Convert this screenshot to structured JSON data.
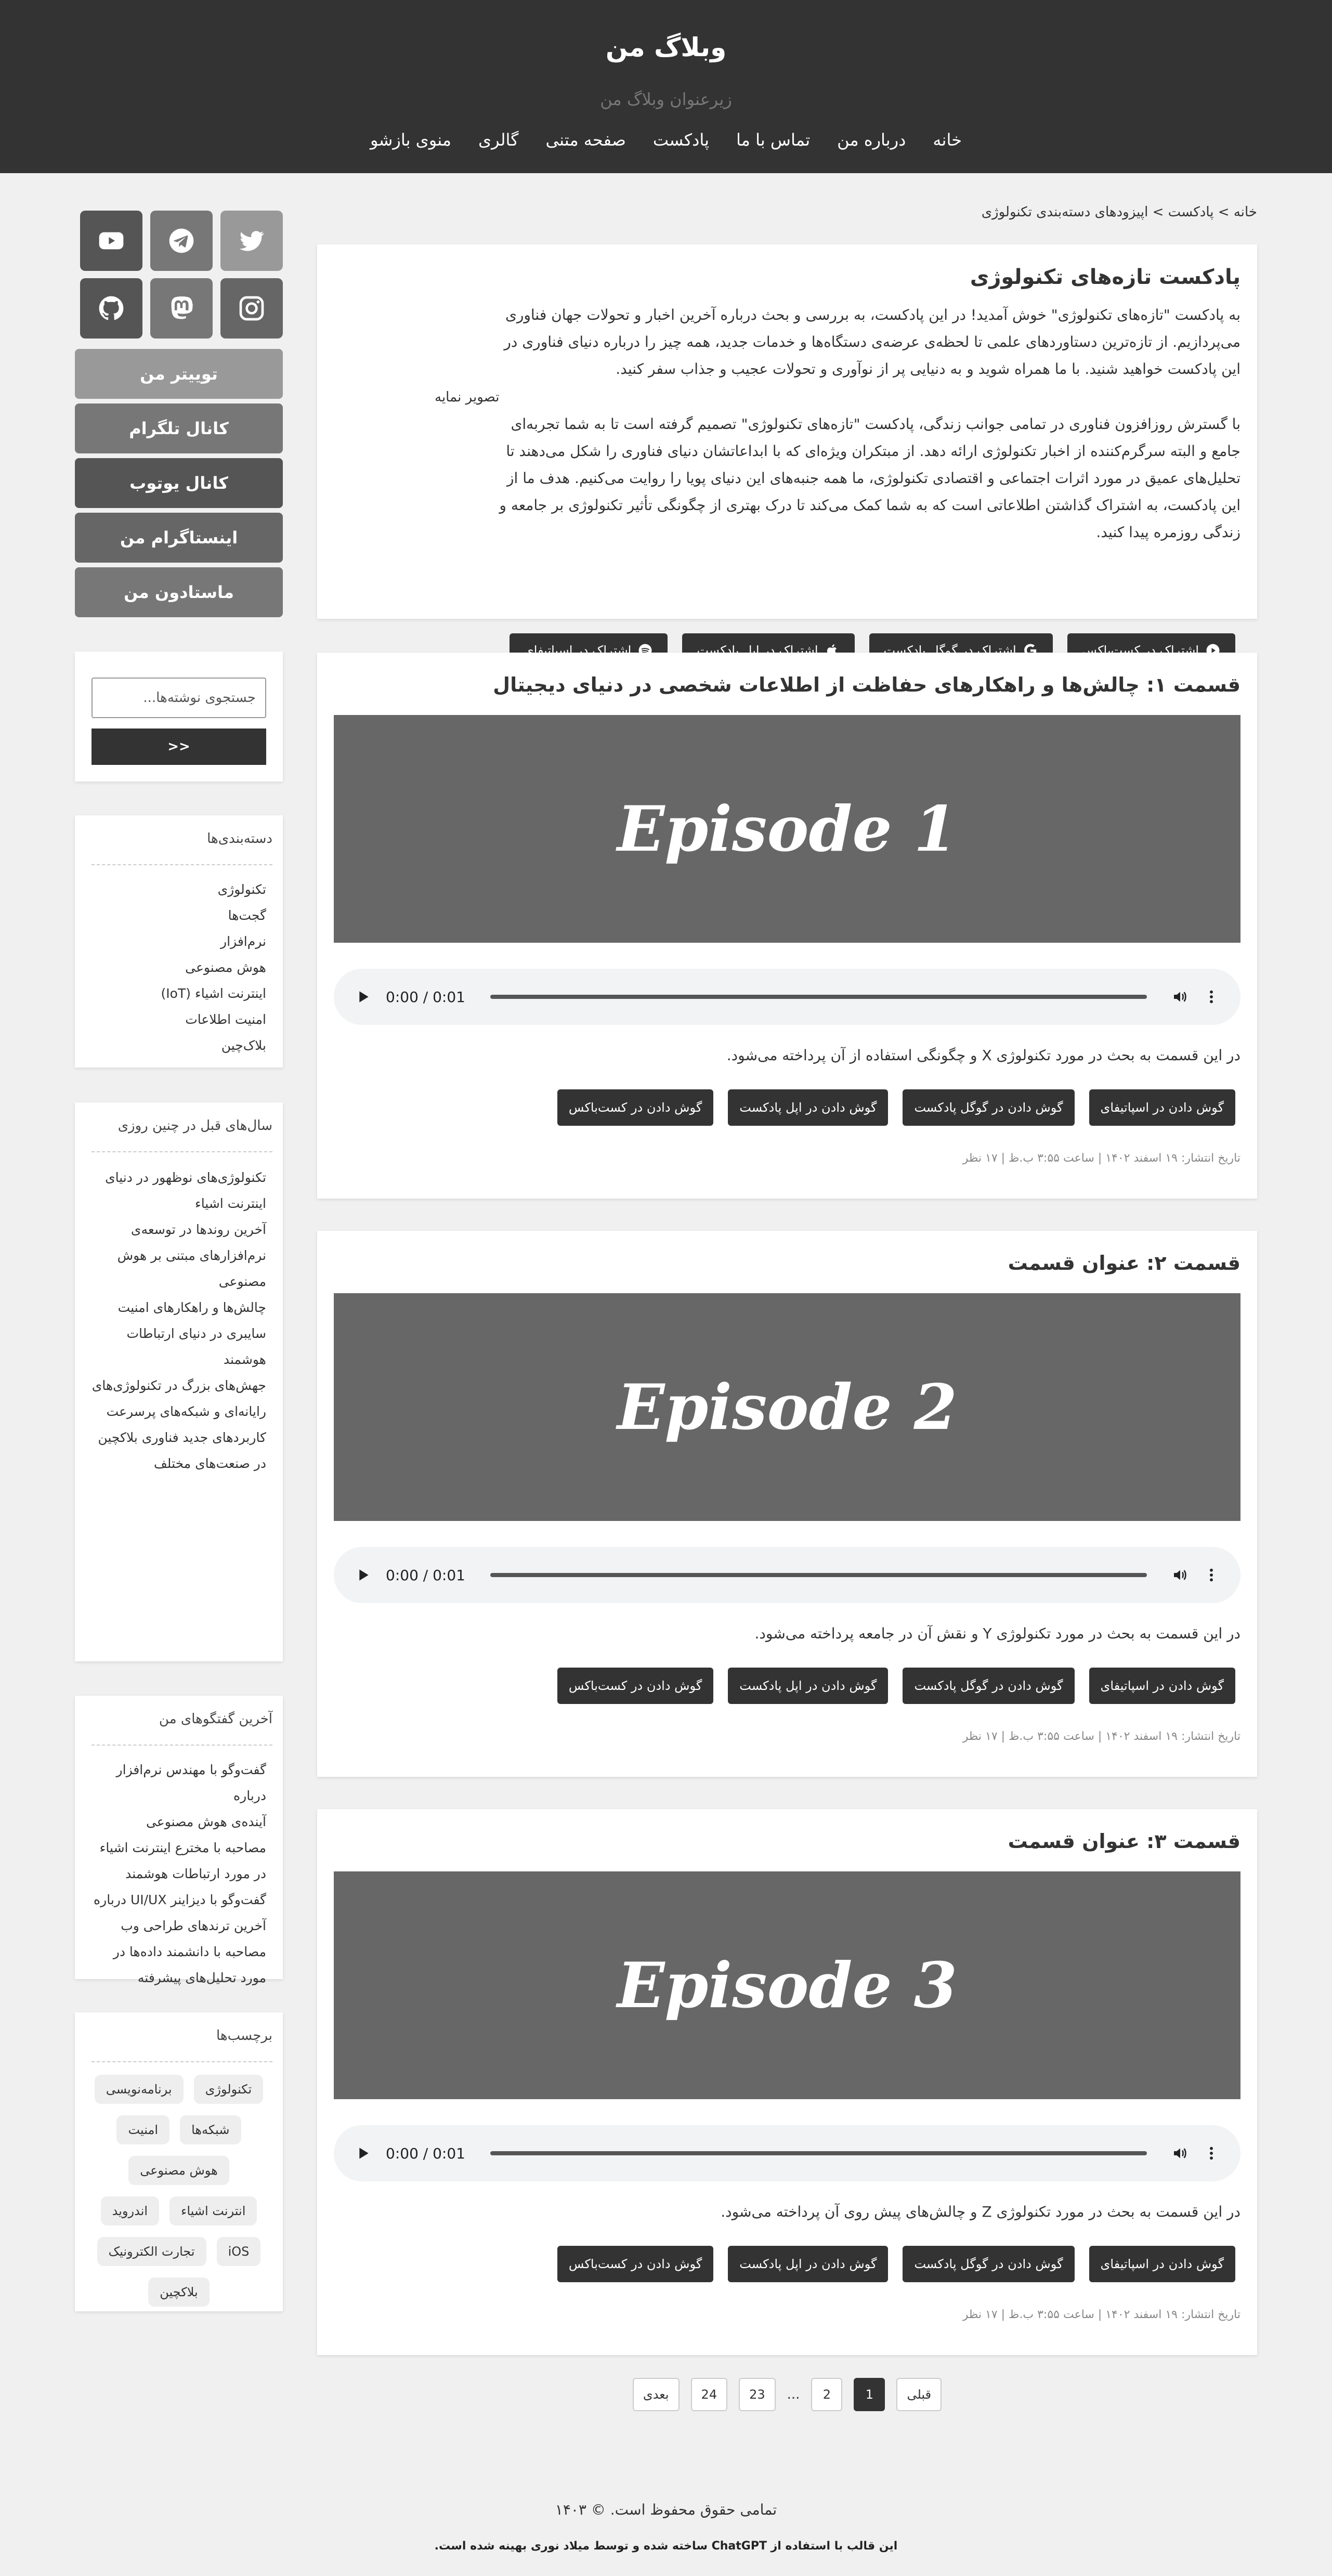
{
  "header": {
    "title": "وبلاگ من",
    "tagline": "زیرعنوان وبلاگ من",
    "nav": [
      "خانه",
      "درباره من",
      "تماس با ما",
      "پادکست",
      "صفحه متنی",
      "گالری",
      "منوی بازشو"
    ]
  },
  "breadcrumb": "خانه > پادکست > اپیزودهای دسته‌بندی تکنولوژی",
  "intro": {
    "title": "پادکست تازه‌های تکنولوژی",
    "paragraph1": "به پادکست \"تازه‌های تکنولوژی\" خوش آمدید! در این پادکست، به بررسی و بحث درباره آخرین اخبار و تحولات جهان فناوری می‌پردازیم. از تازه‌ترین دستاوردهای علمی تا لحظه‌ی عرضه‌ی دستگاه‌ها و خدمات جدید، همه چیز را درباره دنیای فناوری در این پادکست خواهید شنید. با ما همراه شوید و به دنیایی پر از نوآوری و تحولات عجیب و جذاب سفر کنید.",
    "paragraph2": "با گسترش روزافزون فناوری در تمامی جوانب زندگی، پادکست \"تازه‌های تکنولوژی\" تصمیم گرفته است تا به شما تجربه‌ای جامع و البته سرگرم‌کننده از اخبار تکنولوژی ارائه دهد. از مبتکران ویژه‌ای که با ابداعاتشان دنیای فناوری را شکل می‌دهند تا تحلیل‌های عمیق در مورد اثرات اجتماعی و اقتصادی تکنولوژی، ما همه جنبه‌های این دنیای پویا را روایت می‌کنیم. هدف ما از این پادکست، به اشتراک گذاشتن اطلاعاتی است که به شما کمک می‌کند تا درک بهتری از چگونگی تأثیر تکنولوژی بر جامعه و زندگی روزمره پیدا کنید.",
    "image_alt": "تصویر نمایه",
    "buttons": [
      "اشتراک در کست‌باکس",
      "اشتراک در گوگل پادکست",
      "اشتراک در اپل پادکست",
      "اشتراک در اسپاتیفای"
    ]
  },
  "episodes": [
    {
      "title": "قسمت ۱: چالش‌ها و راهکارهای حفاظت از اطلاعات شخصی در دنیای دیجیتال",
      "cover_text": "Episode 1",
      "time": "0:00 / 0:01",
      "description": "در این قسمت به بحث در مورد تکنولوژی X و چگونگی استفاده از آن پرداخته می‌شود.",
      "buttons": [
        "گوش دادن در اسپاتیفای",
        "گوش دادن در گوگل پادکست",
        "گوش دادن در اپل پادکست",
        "گوش دادن در کست‌باکس"
      ],
      "meta": "تاریخ انتشار: ۱۹ اسفند ۱۴۰۲ | ساعت ۳:۵۵ ب.ظ | ۱۷ نظر"
    },
    {
      "title": "قسمت ۲: عنوان قسمت",
      "cover_text": "Episode 2",
      "time": "0:00 / 0:01",
      "description": "در این قسمت به بحث در مورد تکنولوژی Y و نقش آن در جامعه پرداخته می‌شود.",
      "buttons": [
        "گوش دادن در اسپاتیفای",
        "گوش دادن در گوگل پادکست",
        "گوش دادن در اپل پادکست",
        "گوش دادن در کست‌باکس"
      ],
      "meta": "تاریخ انتشار: ۱۹ اسفند ۱۴۰۲ | ساعت ۳:۵۵ ب.ظ | ۱۷ نظر"
    },
    {
      "title": "قسمت ۳: عنوان قسمت",
      "cover_text": "Episode 3",
      "time": "0:00 / 0:01",
      "description": "در این قسمت به بحث در مورد تکنولوژی Z و چالش‌های پیش روی آن پرداخته می‌شود.",
      "buttons": [
        "گوش دادن در اسپاتیفای",
        "گوش دادن در گوگل پادکست",
        "گوش دادن در اپل پادکست",
        "گوش دادن در کست‌باکس"
      ],
      "meta": "تاریخ انتشار: ۱۹ اسفند ۱۴۰۲ | ساعت ۳:۵۵ ب.ظ | ۱۷ نظر"
    }
  ],
  "pagination": {
    "prev": "قبلی",
    "pages": [
      "1",
      "2",
      "23",
      "24"
    ],
    "ellipsis": "...",
    "current": "1",
    "next": "بعدی"
  },
  "sidebar": {
    "social_icons": [
      "twitter-icon",
      "telegram-icon",
      "youtube-icon",
      "instagram-icon",
      "mastodon-icon",
      "github-icon"
    ],
    "social_buttons": [
      "توییتر من",
      "کانال تلگرام",
      "کانال یوتوب",
      "اینستاگرام من",
      "ماستادون من"
    ],
    "search": {
      "placeholder": "جستجوی نوشته‌ها...",
      "button": ">>"
    },
    "categories": {
      "title": "دسته‌بندی‌ها",
      "items": [
        "تکنولوژی",
        "گجت‌ها",
        "نرم‌افزار",
        "هوش مصنوعی",
        "اینترنت اشیاء (IoT)",
        "امنیت اطلاعات",
        "بلاک‌چین"
      ]
    },
    "years_ago": {
      "title": "سال‌های قبل در چنین روزی",
      "items": [
        "تکنولوژی‌های نوظهور در دنیای",
        "اینترنت اشیاء",
        "آخرین روندها در توسعه‌ی",
        "نرم‌افزارهای مبتنی بر هوش",
        "مصنوعی",
        "چالش‌ها و راهکارهای امنیت",
        "سایبری در دنیای ارتباطات",
        "هوشمند",
        "جهش‌های بزرگ در تکنولوژی‌های",
        "رایانه‌ای و شبکه‌های پرسرعت",
        "کاربردهای جدید فناوری بلاکچین",
        "در صنعت‌های مختلف"
      ]
    },
    "talks": {
      "title": "آخرین گفتگوهای من",
      "items": [
        "گفت‌وگو با مهندس نرم‌افزار درباره",
        "آینده‌ی هوش مصنوعی",
        "مصاحبه با مخترع اینترنت اشیاء",
        "در مورد ارتباطات هوشمند",
        "گفت‌وگو با دیزاینر UI/UX درباره",
        "آخرین ترندهای طراحی وب",
        "مصاحبه با دانشمند داده‌ها در",
        "مورد تحلیل‌های پیشرفته"
      ]
    },
    "tags": {
      "title": "برچسب‌ها",
      "items": [
        "تکنولوژی",
        "برنامه‌نویسی",
        "شبکه‌ها",
        "امنیت",
        "هوش مصنوعی",
        "انترنت اشیاء",
        "اندروید",
        "iOS",
        "تجارت الکترونیک",
        "بلاکچین"
      ]
    }
  },
  "footer": {
    "copyright": "تمامی حقوق محفوظ است. © ۱۴۰۳",
    "credit": "این قالب با استفاده از ChatGPT ساخته شده و توسط میلاد نوری بهینه شده است."
  }
}
